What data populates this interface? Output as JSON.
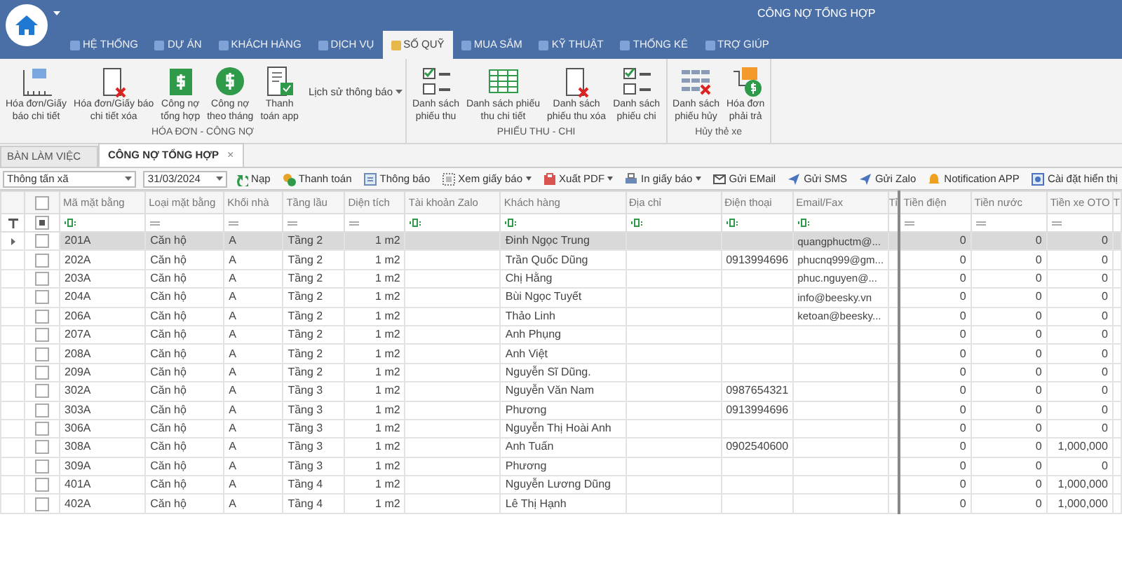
{
  "window": {
    "title": "CÔNG NỢ TỔNG HỢP"
  },
  "menu_tabs": [
    {
      "label": "HỆ THỐNG",
      "selected": false
    },
    {
      "label": "DỰ ÁN",
      "selected": false
    },
    {
      "label": "KHÁCH HÀNG",
      "selected": false
    },
    {
      "label": "DỊCH VỤ",
      "selected": false
    },
    {
      "label": "SỐ QUỸ",
      "selected": true
    },
    {
      "label": "MUA SẮM",
      "selected": false
    },
    {
      "label": "KỸ THUẬT",
      "selected": false
    },
    {
      "label": "THỐNG KÊ",
      "selected": false
    },
    {
      "label": "TRỢ GIÚP",
      "selected": false
    }
  ],
  "ribbon_groups": [
    {
      "label": "HÓA ĐƠN - CÔNG NỢ",
      "buttons": [
        {
          "lines": [
            "Hóa đơn/Giấy",
            "báo chi tiết"
          ]
        },
        {
          "lines": [
            "Hóa đơn/Giấy báo",
            "chi tiết xóa"
          ]
        },
        {
          "lines": [
            "Công nợ",
            "tổng hợp"
          ]
        },
        {
          "lines": [
            "Công nợ",
            "theo tháng"
          ]
        },
        {
          "lines": [
            "Thanh",
            "toán app"
          ]
        }
      ],
      "dropdown": "Lịch sử thông báo"
    },
    {
      "label": "PHIẾU THU - CHI",
      "buttons": [
        {
          "lines": [
            "Danh sách",
            "phiếu thu"
          ]
        },
        {
          "lines": [
            "Danh sách phiếu",
            "thu chi tiết"
          ]
        },
        {
          "lines": [
            "Danh sách",
            "phiếu thu xóa"
          ]
        },
        {
          "lines": [
            "Danh sách",
            "phiếu chi"
          ]
        }
      ]
    },
    {
      "label": "Hủy thẻ xe",
      "buttons": [
        {
          "lines": [
            "Danh sách",
            "phiếu hủy"
          ]
        },
        {
          "lines": [
            "Hóa đơn",
            "phải trả"
          ]
        }
      ]
    }
  ],
  "doc_tabs": [
    {
      "label": "BÀN LÀM VIỆC",
      "selected": false
    },
    {
      "label": "CÔNG NỢ TỔNG HỢP",
      "selected": true,
      "close": "×"
    }
  ],
  "toolbar": {
    "project": "Thông tấn xã",
    "date": "31/03/2024",
    "buttons": [
      {
        "label": "Nạp",
        "dropdown": false
      },
      {
        "label": "Thanh toán",
        "dropdown": false
      },
      {
        "label": "Thông báo",
        "dropdown": false
      },
      {
        "label": "Xem giấy báo",
        "dropdown": true
      },
      {
        "label": "Xuất PDF",
        "dropdown": true
      },
      {
        "label": "In giấy báo",
        "dropdown": true
      },
      {
        "label": "Gửi EMail",
        "dropdown": false
      },
      {
        "label": "Gửi SMS",
        "dropdown": false
      },
      {
        "label": "Gửi Zalo",
        "dropdown": false
      },
      {
        "label": "Notification APP",
        "dropdown": false
      },
      {
        "label": "Cài đặt hiển thị",
        "dropdown": false
      }
    ]
  },
  "grid": {
    "select_all": {
      "checked": false
    },
    "filter_checkbox": {
      "indeterminate": true
    },
    "columns": [
      {
        "label": "Mã mặt bằng",
        "kind": "text"
      },
      {
        "label": "Loại mặt bằng",
        "kind": "list"
      },
      {
        "label": "Khối nhà",
        "kind": "list"
      },
      {
        "label": "Tầng lầu",
        "kind": "list"
      },
      {
        "label": "Diện tích",
        "kind": "number"
      },
      {
        "label": "Tài khoản Zalo",
        "kind": "text"
      },
      {
        "label": "Khách hàng",
        "kind": "text"
      },
      {
        "label": "Địa chỉ",
        "kind": "text"
      },
      {
        "label": "Điện thoại",
        "kind": "text"
      },
      {
        "label": "Email/Fax",
        "kind": "text"
      },
      {
        "label": "Tỉ",
        "kind": "cut"
      },
      {
        "label": "Tiền điện",
        "kind": "number"
      },
      {
        "label": "Tiền nước",
        "kind": "number"
      },
      {
        "label": "Tiền xe OTO",
        "kind": "number"
      },
      {
        "label": "T",
        "kind": "cut"
      }
    ],
    "rows": [
      {
        "selected": true,
        "checked": false,
        "cells": [
          "201A",
          "Căn hộ",
          "A",
          "Tầng 2",
          "1 m2",
          null,
          "Đinh Ngọc Trung",
          null,
          null,
          "quangphuctm@...",
          null,
          "0",
          "0",
          "0",
          null
        ]
      },
      {
        "selected": false,
        "checked": false,
        "cells": [
          "202A",
          "Căn hộ",
          "A",
          "Tầng 2",
          "1 m2",
          null,
          "Trần Quốc Dũng",
          null,
          "0913994696",
          "phucnq999@gm...",
          null,
          "0",
          "0",
          "0",
          null
        ]
      },
      {
        "selected": false,
        "checked": false,
        "cells": [
          "203A",
          "Căn hộ",
          "A",
          "Tầng 2",
          "1 m2",
          null,
          "Chị Hằng",
          null,
          null,
          "phuc.nguyen@...",
          null,
          "0",
          "0",
          "0",
          null
        ]
      },
      {
        "selected": false,
        "checked": false,
        "cells": [
          "204A",
          "Căn hộ",
          "A",
          "Tầng 2",
          "1 m2",
          null,
          "Bùi Ngọc Tuyết",
          null,
          null,
          "info@beesky.vn",
          null,
          "0",
          "0",
          "0",
          null
        ]
      },
      {
        "selected": false,
        "checked": false,
        "cells": [
          "206A",
          "Căn hộ",
          "A",
          "Tầng 2",
          "1 m2",
          null,
          "Thảo Linh",
          null,
          null,
          "ketoan@beesky...",
          null,
          "0",
          "0",
          "0",
          null
        ]
      },
      {
        "selected": false,
        "checked": false,
        "cells": [
          "207A",
          "Căn hộ",
          "A",
          "Tầng 2",
          "1 m2",
          null,
          "Anh Phụng",
          null,
          null,
          null,
          null,
          "0",
          "0",
          "0",
          null
        ]
      },
      {
        "selected": false,
        "checked": false,
        "cells": [
          "208A",
          "Căn hộ",
          "A",
          "Tầng 2",
          "1 m2",
          null,
          "Anh Việt",
          null,
          null,
          null,
          null,
          "0",
          "0",
          "0",
          null
        ]
      },
      {
        "selected": false,
        "checked": false,
        "cells": [
          "209A",
          "Căn hộ",
          "A",
          "Tầng 2",
          "1 m2",
          null,
          "Nguyễn Sĩ Dũng.",
          null,
          null,
          null,
          null,
          "0",
          "0",
          "0",
          null
        ]
      },
      {
        "selected": false,
        "checked": false,
        "cells": [
          "302A",
          "Căn hộ",
          "A",
          "Tầng 3",
          "1 m2",
          null,
          "Nguyễn Văn Nam",
          null,
          "0987654321",
          null,
          null,
          "0",
          "0",
          "0",
          null
        ]
      },
      {
        "selected": false,
        "checked": false,
        "cells": [
          "303A",
          "Căn hộ",
          "A",
          "Tầng 3",
          "1 m2",
          null,
          "Phương",
          null,
          "0913994696",
          null,
          null,
          "0",
          "0",
          "0",
          null
        ]
      },
      {
        "selected": false,
        "checked": false,
        "cells": [
          "306A",
          "Căn hộ",
          "A",
          "Tầng 3",
          "1 m2",
          null,
          "Nguyễn Thị Hoài Anh",
          null,
          null,
          null,
          null,
          "0",
          "0",
          "0",
          null
        ]
      },
      {
        "selected": false,
        "checked": false,
        "cells": [
          "308A",
          "Căn hộ",
          "A",
          "Tầng 3",
          "1 m2",
          null,
          "Anh Tuấn",
          null,
          "0902540600",
          null,
          null,
          "0",
          "0",
          "1,000,000",
          null
        ]
      },
      {
        "selected": false,
        "checked": false,
        "cells": [
          "309A",
          "Căn hộ",
          "A",
          "Tầng 3",
          "1 m2",
          null,
          "Phương",
          null,
          null,
          null,
          null,
          "0",
          "0",
          "0",
          null
        ]
      },
      {
        "selected": false,
        "checked": false,
        "cells": [
          "401A",
          "Căn hộ",
          "A",
          "Tầng 4",
          "1 m2",
          null,
          "Nguyễn Lương Dũng",
          null,
          null,
          null,
          null,
          "0",
          "0",
          "1,000,000",
          null
        ]
      },
      {
        "selected": false,
        "checked": false,
        "cells": [
          "402A",
          "Căn hộ",
          "A",
          "Tầng 4",
          "1 m2",
          null,
          "Lê Thị Hạnh",
          null,
          null,
          null,
          null,
          "0",
          "0",
          "1,000,000",
          null
        ]
      }
    ]
  }
}
